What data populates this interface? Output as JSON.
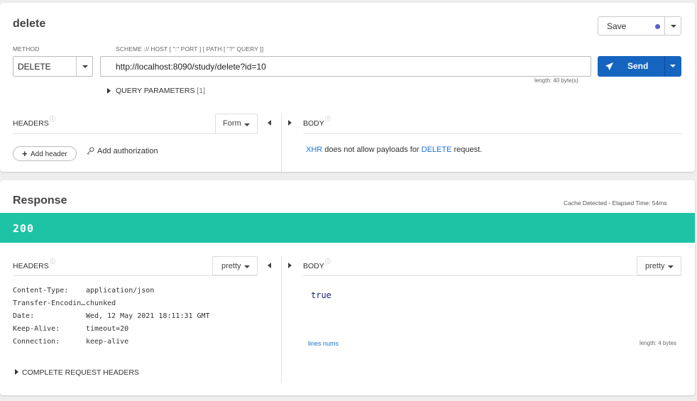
{
  "request": {
    "name": "delete",
    "save_label": "Save",
    "method_label": "METHOD",
    "method_value": "DELETE",
    "url_label": "SCHEME :// HOST [ \":\" PORT ] [ PATH [ \"?\" QUERY ]]",
    "url_value": "http://localhost:8090/study/delete?id=10",
    "send_label": "Send",
    "length_text": "length: 40 byte(s)",
    "query_params_label": "QUERY PARAMETERS",
    "query_params_count": "[1]",
    "headers_label": "HEADERS",
    "headers_mode": "Form",
    "body_label": "BODY",
    "add_header_label": "Add header",
    "add_authorization_label": "Add authorization",
    "body_message": {
      "xhr": "XHR",
      "middle": " does not allow payloads for ",
      "method": "DELETE",
      "end": " request."
    }
  },
  "response": {
    "title": "Response",
    "cache_text": "Cache Detected - Elapsed Time: 54ms",
    "status_code": "200",
    "headers_label": "HEADERS",
    "headers_mode": "pretty",
    "body_label": "BODY",
    "body_mode": "pretty",
    "headers": [
      {
        "name": "Content-Type:",
        "value": "application/json"
      },
      {
        "name": "Transfer-Encodin…",
        "value": "chunked"
      },
      {
        "name": "Date:",
        "value": "Wed, 12 May 2021 18:11:31 GMT"
      },
      {
        "name": "Keep-Alive:",
        "value": "timeout=20"
      },
      {
        "name": "Connection:",
        "value": "keep-alive"
      }
    ],
    "body_value": "true",
    "lines_nums_label": "lines nums",
    "body_length": "length: 4 bytes",
    "complete_headers_label": "COMPLETE REQUEST HEADERS"
  },
  "colors": {
    "send_blue": "#1565c0",
    "status_green": "#1ec3a6",
    "link_blue": "#1976d2",
    "dot_purple": "#5b5fc7"
  },
  "icons": [
    "caret-down-icon",
    "paper-plane-icon",
    "triangle-right-icon",
    "help-icon",
    "arrow-left-icon",
    "arrow-right-icon",
    "plus-icon",
    "key-icon"
  ]
}
